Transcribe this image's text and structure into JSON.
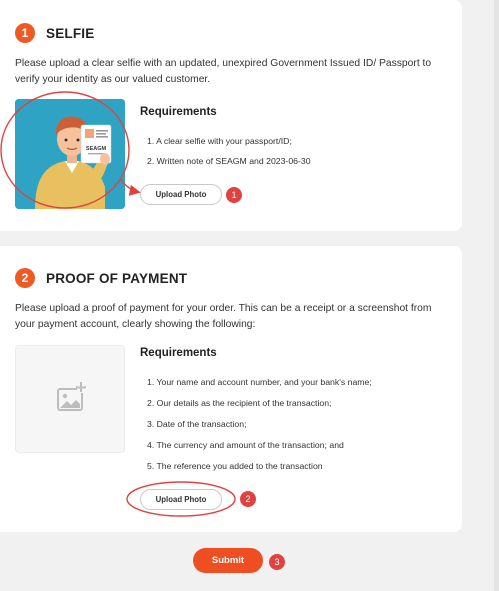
{
  "colors": {
    "accent": "#ef5a24",
    "annotation_red": "#e0433f",
    "selfie_bg": "#2fa3c4"
  },
  "selfie_section": {
    "step_number": "1",
    "title": "SELFIE",
    "description": "Please upload a clear selfie with an updated, unexpired Government Issued ID/ Passport to verify your identity as our valued customer.",
    "requirements_title": "Requirements",
    "requirements": [
      "1. A clear selfie with your passport/ID;",
      "2. Written note of SEAGM and 2023-06-30"
    ],
    "illustration_label": "SEAGM",
    "upload_label": "Upload Photo",
    "annotation_number": "1"
  },
  "payment_section": {
    "step_number": "2",
    "title": "PROOF OF PAYMENT",
    "description": "Please upload a proof of payment for your order. This can be a receipt or a screenshot from your payment account, clearly showing the following:",
    "requirements_title": "Requirements",
    "requirements": [
      "1. Your name and account number, and your bank's name;",
      "2. Our details as the recipient of the transaction;",
      "3. Date of the transaction;",
      "4. The currency and amount of the transaction; and",
      "5. The reference you added to the transaction"
    ],
    "placeholder_icon": "add-image-icon",
    "upload_label": "Upload Photo",
    "annotation_number": "2"
  },
  "submit": {
    "label": "Submit",
    "annotation_number": "3"
  }
}
